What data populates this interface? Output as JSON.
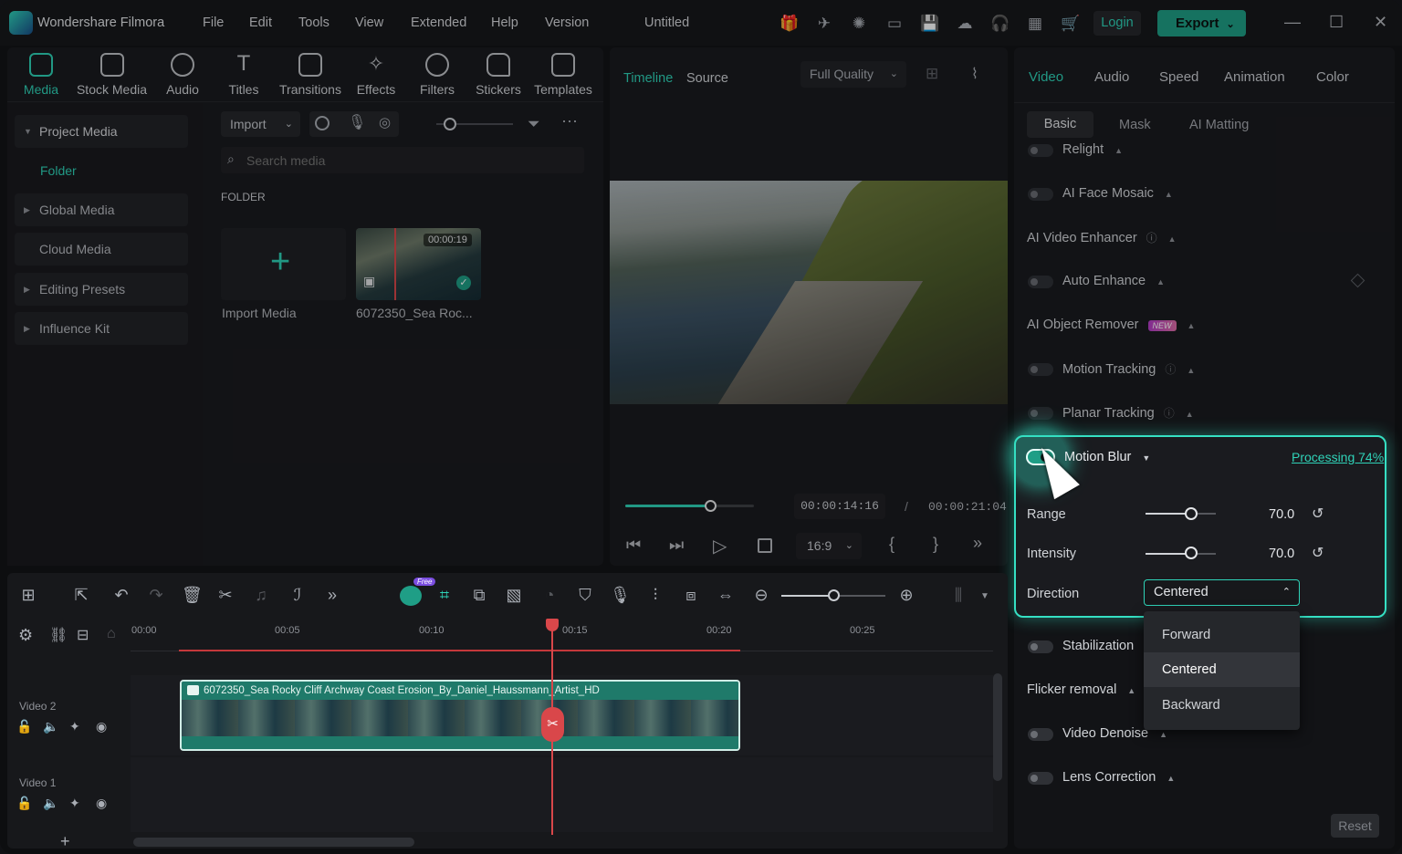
{
  "app": {
    "name": "Wondershare Filmora",
    "project": "Untitled"
  },
  "menu": [
    "File",
    "Edit",
    "Tools",
    "View",
    "Extended",
    "Help",
    "Version"
  ],
  "titlebar": {
    "login": "Login",
    "export": "Export"
  },
  "toolbar": [
    "Media",
    "Stock Media",
    "Audio",
    "Titles",
    "Transitions",
    "Effects",
    "Filters",
    "Stickers",
    "Templates"
  ],
  "sidebar": [
    "Project Media",
    "Folder",
    "Global Media",
    "Cloud Media",
    "Editing Presets",
    "Influence Kit"
  ],
  "media": {
    "import_label": "Import",
    "search_placeholder": "Search media",
    "folder_label": "FOLDER",
    "import_media": "Import Media",
    "clip_name": "6072350_Sea Roc...",
    "clip_duration": "00:00:19"
  },
  "preview": {
    "tab_timeline": "Timeline",
    "tab_source": "Source",
    "quality": "Full Quality",
    "current_time": "00:00:14:16",
    "separator": "/",
    "total_time": "00:00:21:04",
    "aspect": "16:9",
    "progress": 0.66
  },
  "right_panel": {
    "tabs": [
      "Video",
      "Audio",
      "Speed",
      "Animation",
      "Color"
    ],
    "subtabs": [
      "Basic",
      "Mask",
      "AI Matting"
    ],
    "rows": {
      "relight": "Relight",
      "face_mosaic": "AI Face Mosaic",
      "enhancer": "AI Video Enhancer",
      "auto_enhance": "Auto Enhance",
      "object_remover": "AI Object Remover",
      "new_badge": "NEW",
      "motion_tracking": "Motion Tracking",
      "planar_tracking": "Planar Tracking",
      "motion_blur": "Motion Blur",
      "processing": "Processing 74%",
      "range_label": "Range",
      "range_value": "70.0",
      "intensity_label": "Intensity",
      "intensity_value": "70.0",
      "direction_label": "Direction",
      "direction_value": "Centered",
      "stabilization": "Stabilization",
      "flicker": "Flicker removal",
      "denoise": "Video Denoise",
      "lens": "Lens Correction"
    },
    "dropdown_options": [
      "Forward",
      "Centered",
      "Backward"
    ],
    "reset": "Reset"
  },
  "timeline": {
    "free_badge": "Free",
    "ruler": [
      "00:00",
      "00:05",
      "00:10",
      "00:15",
      "00:20",
      "00:25"
    ],
    "track2": "Video 2",
    "track1": "Video 1",
    "clip_title": "6072350_Sea Rocky Cliff Archway Coast Erosion_By_Daniel_Haussmann_Artist_HD",
    "add": "+"
  },
  "colors": {
    "accent": "#2fd3b8",
    "playhead": "#d9474a",
    "clip": "#1f7a6a"
  }
}
